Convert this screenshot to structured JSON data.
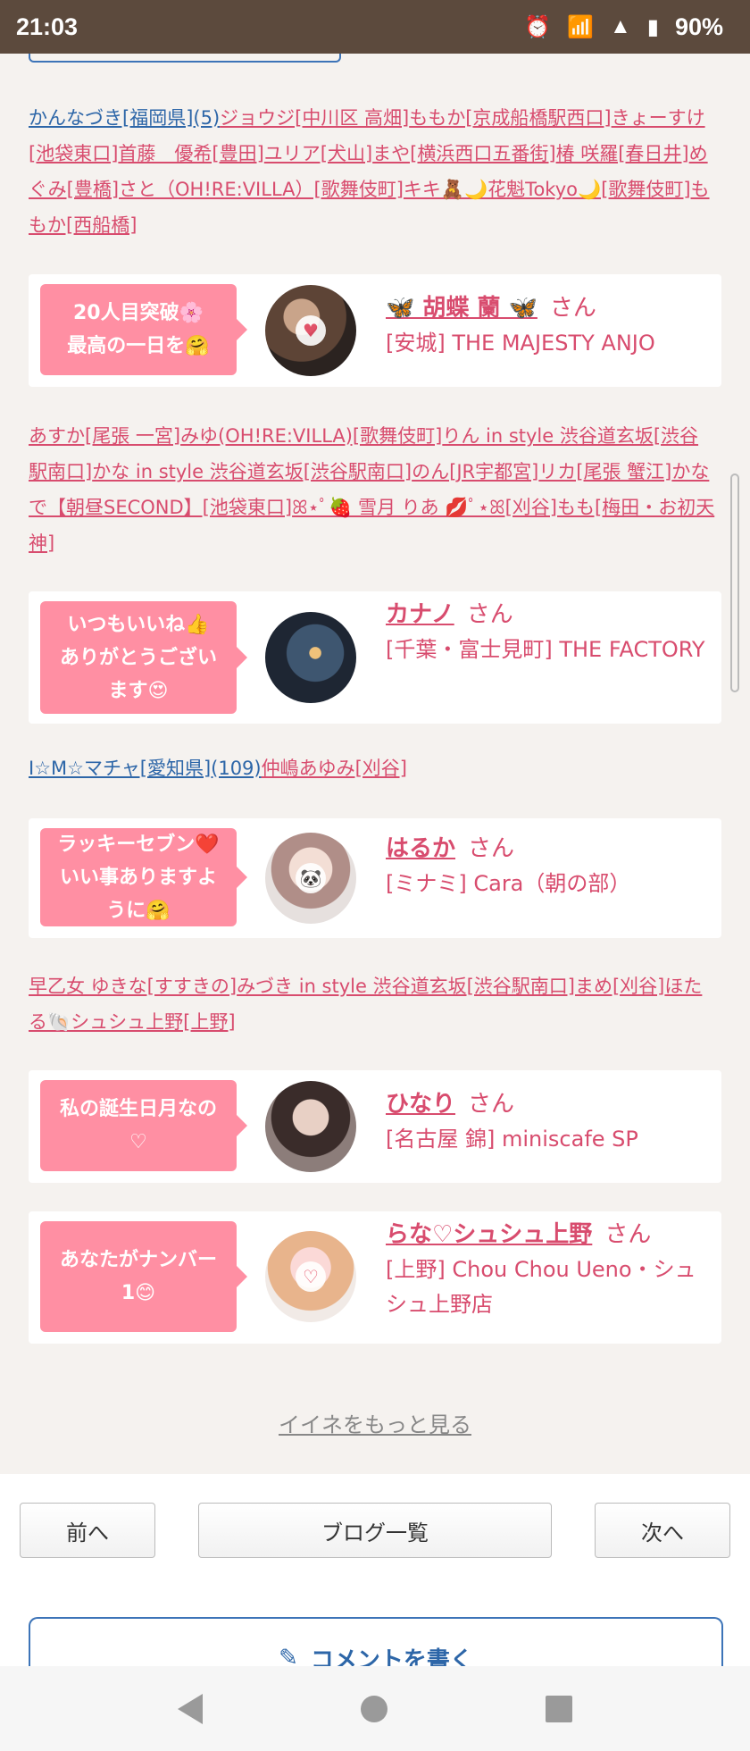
{
  "status_bar": {
    "time": "21:03",
    "battery": "90%",
    "alarm_icon": "alarm-icon",
    "wifi_icon": "wifi-icon",
    "signal_icon": "signal-icon",
    "battery_icon": "battery-icon"
  },
  "name_lists": [
    {
      "items": [
        {
          "text": "かんなづき[福岡県](5)",
          "color": "blue"
        },
        {
          "text": "ジョウジ[中川区 高畑]",
          "color": "pink"
        },
        {
          "text": "ももか[京成船橋駅西口]",
          "color": "pink"
        },
        {
          "text": "きょーすけ[池袋東口]",
          "color": "pink"
        },
        {
          "text": "首藤　優希[豊田]",
          "color": "pink"
        },
        {
          "text": "ユリア[犬山]",
          "color": "pink"
        },
        {
          "text": "まや[横浜西口五番街]",
          "color": "pink"
        },
        {
          "text": "椿 咲羅[春日井]",
          "color": "pink"
        },
        {
          "text": "めぐみ[豊橋]",
          "color": "pink"
        },
        {
          "text": "さと（OH!RE:VILLA）[歌舞伎町]",
          "color": "pink"
        },
        {
          "text": "キキ🧸🌙花魁Tokyo🌙[歌舞伎町]",
          "color": "pink"
        },
        {
          "text": "ももか[西船橋]",
          "color": "pink"
        }
      ]
    },
    {
      "items": [
        {
          "text": "あすか[尾張 一宮]",
          "color": "pink"
        },
        {
          "text": "みゆ(OH!RE:VILLA)[歌舞伎町]",
          "color": "pink"
        },
        {
          "text": "りん in style 渋谷道玄坂[渋谷駅南口]",
          "color": "pink"
        },
        {
          "text": "かな in style 渋谷道玄坂[渋谷駅南口]",
          "color": "pink"
        },
        {
          "text": "のん[JR宇都宮]",
          "color": "pink"
        },
        {
          "text": "リカ[尾張 蟹江]",
          "color": "pink"
        },
        {
          "text": "かなで【朝昼SECOND】[池袋東口]",
          "color": "pink"
        },
        {
          "text": "ꕤ⋆ﾟ🍓 雪月 りあ 💋ﾟ⋆ꕤ[刈谷]",
          "color": "pink"
        },
        {
          "text": "もも[梅田・お初天神]",
          "color": "pink"
        }
      ]
    },
    {
      "items": [
        {
          "text": "I☆M☆マチャ[愛知県](109)",
          "color": "blue"
        },
        {
          "text": "仲嶋あゆみ[刈谷]",
          "color": "pink"
        }
      ]
    },
    {
      "items": [
        {
          "text": "早乙女 ゆきな[すすきの]",
          "color": "pink"
        },
        {
          "text": "みづき in style 渋谷道玄坂[渋谷駅南口]",
          "color": "pink"
        },
        {
          "text": "まめ[刈谷]",
          "color": "pink"
        },
        {
          "text": "ほたる🐚シュシュ上野[上野]",
          "color": "pink"
        }
      ]
    }
  ],
  "cards": [
    {
      "bubble_lines": [
        "20人目突破🌸",
        "最高の一日を🤗"
      ],
      "name": "🦋 胡蝶 蘭 🦋",
      "suffix": "さん",
      "shop": "[安城] THE MAJESTY ANJO"
    },
    {
      "bubble_lines": [
        "いつもいいね👍",
        "ありがとうござい",
        "ます😍"
      ],
      "name": "カナノ",
      "suffix": "さん",
      "shop": "[千葉・富士見町] THE FACTORY"
    },
    {
      "bubble_lines": [
        "ラッキーセブン❤️",
        "いい事ありますよ",
        "うに🤗"
      ],
      "name": "はるか",
      "suffix": "さん",
      "shop": "[ミナミ] Cara（朝の部）"
    },
    {
      "bubble_lines": [
        "私の誕生日月なの",
        "♡"
      ],
      "name": "ひなり",
      "suffix": "さん",
      "shop": "[名古屋 錦] miniscafe SP"
    },
    {
      "bubble_lines": [
        "あなたがナンバー",
        "1😊"
      ],
      "name": "らな♡シュシュ上野",
      "suffix": "さん",
      "shop": "[上野] Chou Chou Ueno・シュシュ上野店"
    }
  ],
  "more_link": "イイネをもっと見る",
  "nav": {
    "prev": "前へ",
    "list": "ブログ一覧",
    "next": "次へ"
  },
  "comment_button": "コメントを書く"
}
